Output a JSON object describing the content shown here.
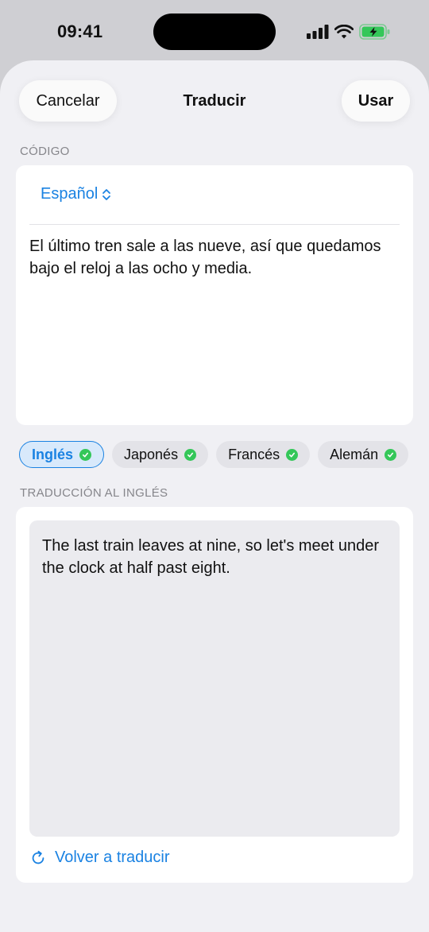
{
  "status_bar": {
    "time": "09:41",
    "icons": [
      "cellular-signal-icon",
      "wifi-icon",
      "battery-charging-icon"
    ]
  },
  "nav": {
    "cancel_label": "Cancelar",
    "title": "Traducir",
    "use_label": "Usar"
  },
  "source": {
    "section_label": "CÓDIGO",
    "language": "Español",
    "text": "El último tren sale a las nueve, así que quedamos bajo el reloj a las ocho y media."
  },
  "languages": [
    {
      "label": "Inglés",
      "selected": true,
      "downloaded": true
    },
    {
      "label": "Japonés",
      "selected": false,
      "downloaded": true
    },
    {
      "label": "Francés",
      "selected": false,
      "downloaded": true
    },
    {
      "label": "Alemán",
      "selected": false,
      "downloaded": true
    }
  ],
  "translation": {
    "section_label": "TRADUCCIÓN AL INGLÉS",
    "text": "The last train leaves at nine, so let's meet under the clock at half past eight.",
    "retranslate_label": "Volver a traducir"
  },
  "colors": {
    "accent": "#1a82e2",
    "check": "#34c759",
    "battery": "#34c759"
  }
}
